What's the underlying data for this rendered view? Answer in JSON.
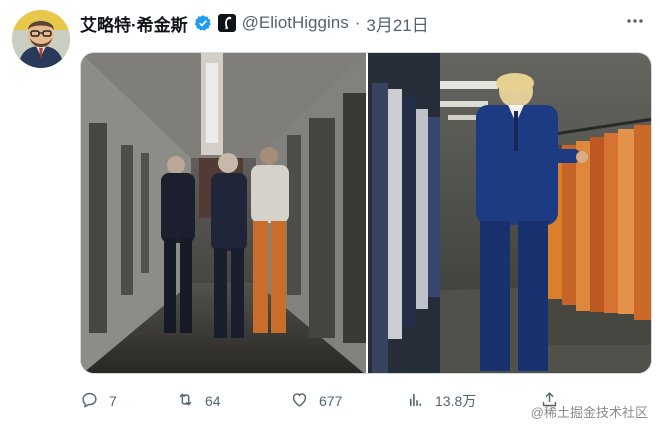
{
  "user": {
    "display_name": "艾略特·希金斯",
    "handle": "@EliotHiggins",
    "separator": "·",
    "date": "3月21日"
  },
  "icons": {
    "avatar": "avatar-caricature",
    "verified": "verified-badge-icon",
    "affiliation": "affiliation-badge-icon",
    "more": "more-icon",
    "reply": "reply-icon",
    "retweet": "retweet-icon",
    "like": "like-icon",
    "views": "views-icon",
    "share": "share-icon"
  },
  "actions": {
    "reply_count": "7",
    "retweet_count": "64",
    "like_count": "677",
    "view_count": "13.8万"
  },
  "watermark": "@稀土掘金技术社区",
  "colors": {
    "verified_blue": "#1d9bf0",
    "text_primary": "#0f1419",
    "text_secondary": "#536471"
  }
}
